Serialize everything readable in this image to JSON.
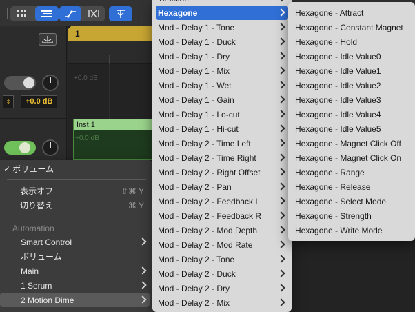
{
  "toolbar": {
    "colors": {
      "accent": "#2f6fd6"
    }
  },
  "tracks": {
    "track1_volume": "+0.0 dB",
    "track1_db_faint": "+0.0 dB",
    "track2_db_faint": "+0.0 dB",
    "ruler_bar": "1",
    "region_name": "Inst 1"
  },
  "context_menu": {
    "volume_checked": "✓ ボリューム",
    "display_off": "表示オフ",
    "display_off_shortcut": "⇧⌘ Y",
    "toggle": "切り替え",
    "toggle_shortcut": "⌘ Y",
    "section_automation": "Automation",
    "items": [
      {
        "label": "Smart Control",
        "submenu": true
      },
      {
        "label": "ボリューム",
        "submenu": false
      },
      {
        "label": "Main",
        "submenu": true
      },
      {
        "label": "1 Serum",
        "submenu": true
      },
      {
        "label": "2 Motion Dime",
        "submenu": true
      }
    ]
  },
  "submenu": {
    "top_partial": "Timeline",
    "items": [
      "Hexagone",
      "Mod - Delay 1 - Tone",
      "Mod - Delay 1 - Duck",
      "Mod - Delay 1 - Dry",
      "Mod - Delay 1 - Mix",
      "Mod - Delay 1 - Wet",
      "Mod - Delay 1 - Gain",
      "Mod - Delay 1 - Lo-cut",
      "Mod - Delay 1 - Hi-cut",
      "Mod - Delay 2 - Time Left",
      "Mod - Delay 2 - Time Right",
      "Mod - Delay 2 - Right Offset",
      "Mod - Delay 2 - Pan",
      "Mod - Delay 2 - Feedback L",
      "Mod - Delay 2 - Feedback R",
      "Mod - Delay 2 - Mod Depth",
      "Mod - Delay 2 - Mod Rate",
      "Mod - Delay 2 - Tone",
      "Mod - Delay 2 - Duck",
      "Mod - Delay 2 - Dry",
      "Mod - Delay 2 - Mix"
    ]
  },
  "hexagone_menu": {
    "items": [
      "Hexagone - Attract",
      "Hexagone - Constant Magnet",
      "Hexagone - Hold",
      "Hexagone - Idle Value0",
      "Hexagone - Idle Value1",
      "Hexagone - Idle Value2",
      "Hexagone - Idle Value3",
      "Hexagone - Idle Value4",
      "Hexagone - Idle Value5",
      "Hexagone - Magnet Click Off",
      "Hexagone - Magnet Click On",
      "Hexagone - Range",
      "Hexagone - Release",
      "Hexagone - Select Mode",
      "Hexagone - Strength",
      "Hexagone - Write Mode"
    ]
  }
}
